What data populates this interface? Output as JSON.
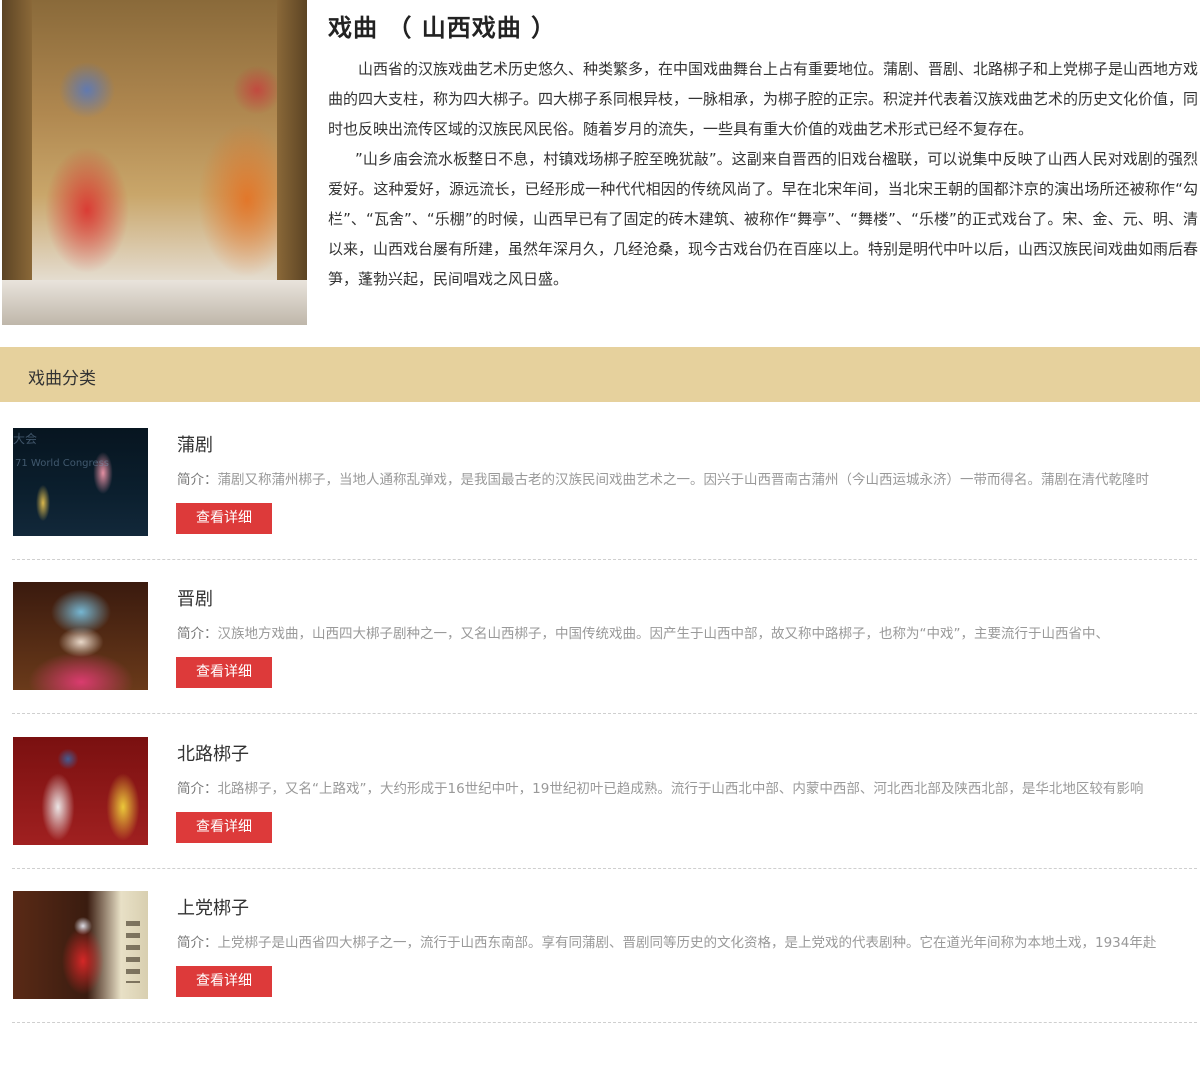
{
  "intro": {
    "title": "戏曲 （ 山西戏曲 ）",
    "paragraph1": "山西省的汉族戏曲艺术历史悠久、种类繁多，在中国戏曲舞台上占有重要地位。蒲剧、晋剧、北路梆子和上党梆子是山西地方戏曲的四大支柱，称为四大梆子。四大梆子系同根异枝，一脉相承，为梆子腔的正宗。积淀并代表着汉族戏曲艺术的历史文化价值，同时也反映出流传区域的汉族民风民俗。随着岁月的流失，一些具有重大价值的戏曲艺术形式已经不复存在。",
    "paragraph2": "”山乡庙会流水板整日不息，村镇戏场梆子腔至晚犹敲”。这副来自晋西的旧戏台楹联，可以说集中反映了山西人民对戏剧的强烈爱好。这种爱好，源远流长，已经形成一种代代相因的传统风尚了。早在北宋年间，当北宋王朝的国都汴京的演出场所还被称作“勾栏”、“瓦舍”、“乐棚”的时候，山西早已有了固定的砖木建筑、被称作“舞亭”、“舞楼”、“乐楼”的正式戏台了。宋、金、元、明、清以来，山西戏台屡有所建，虽然年深月久，几经沧桑，现今古戏台仍在百座以上。特别是明代中叶以后，山西汉族民间戏曲如雨后春笋，蓬勃兴起，民间唱戏之风日盛。"
  },
  "category": {
    "heading": "戏曲分类"
  },
  "items": [
    {
      "name": "蒲剧",
      "desc_label": "简介：",
      "desc": "蒲剧又称蒲州梆子，当地人通称乱弹戏，是我国最古老的汉族民间戏曲艺术之一。因兴于山西晋南古蒲州（今山西运城永济）一带而得名。蒲剧在清代乾隆时",
      "button": "查看详细",
      "watermark1": "大会",
      "watermark2": "71 World Congress"
    },
    {
      "name": "晋剧",
      "desc_label": "简介：",
      "desc": "汉族地方戏曲，山西四大梆子剧种之一，又名山西梆子，中国传统戏曲。因产生于山西中部，故又称中路梆子，也称为“中戏”，主要流行于山西省中、",
      "button": "查看详细"
    },
    {
      "name": "北路梆子",
      "desc_label": "简介：",
      "desc": "北路梆子，又名“上路戏”，大约形成于16世纪中叶，19世纪初叶已趋成熟。流行于山西北中部、内蒙中西部、河北西北部及陕西北部，是华北地区较有影响",
      "button": "查看详细"
    },
    {
      "name": "上党梆子",
      "desc_label": "简介：",
      "desc": "上党梆子是山西省四大梆子之一，流行于山西东南部。享有同蒲剧、晋剧同等历史的文化资格，是上党戏的代表剧种。它在道光年间称为本地土戏，1934年赴",
      "button": "查看详细"
    }
  ]
}
